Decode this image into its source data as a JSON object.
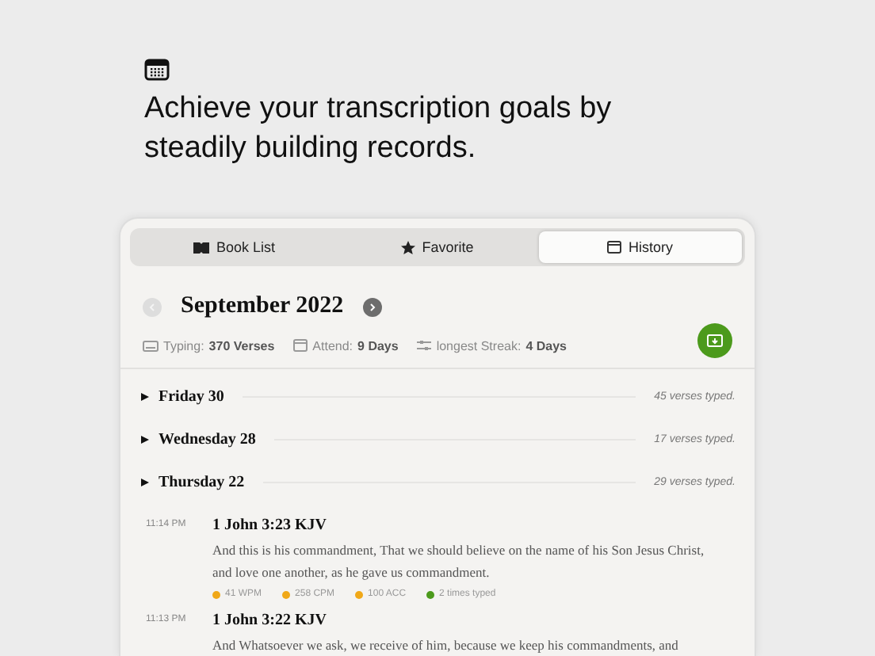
{
  "headline": "Achieve your transcription goals by steadily building records.",
  "tabs": [
    {
      "label": "Book List",
      "kind": "book",
      "selected": false
    },
    {
      "label": "Favorite",
      "kind": "star",
      "selected": false
    },
    {
      "label": "History",
      "kind": "calendar",
      "selected": true
    }
  ],
  "month": {
    "title": "September 2022",
    "prev_disabled": true,
    "next_disabled": false
  },
  "stats": [
    {
      "kind": "keyboard",
      "label": "Typing:",
      "value": "370 Verses"
    },
    {
      "kind": "calendar",
      "label": "Attend:",
      "value": "9 Days"
    },
    {
      "kind": "streak",
      "label": "longest Streak:",
      "value": "4 Days"
    }
  ],
  "days": [
    {
      "title": "Friday 30",
      "summary": "45 verses typed.",
      "expanded": false
    },
    {
      "title": "Wednesday 28",
      "summary": "17 verses typed.",
      "expanded": false
    },
    {
      "title": "Thursday 22",
      "summary": "29 verses typed.",
      "expanded": false
    }
  ],
  "entries": [
    {
      "time": "11:14 PM",
      "reference": "1 John 3:23 KJV",
      "text": "And this is his commandment, That we should believe on the name of his Son Jesus Christ, and love one another, as he gave us commandment.",
      "metrics": [
        {
          "text": "41 WPM",
          "color": "#f0a818"
        },
        {
          "text": "258 CPM",
          "color": "#f0a818"
        },
        {
          "text": "100 ACC",
          "color": "#f0a818"
        },
        {
          "text": "2 times typed",
          "color": "#4c9a1c"
        }
      ]
    },
    {
      "time": "11:13 PM",
      "reference": "1 John 3:22 KJV",
      "text": "And Whatsoever we ask, we receive of him, because we keep his commandments, and"
    }
  ]
}
